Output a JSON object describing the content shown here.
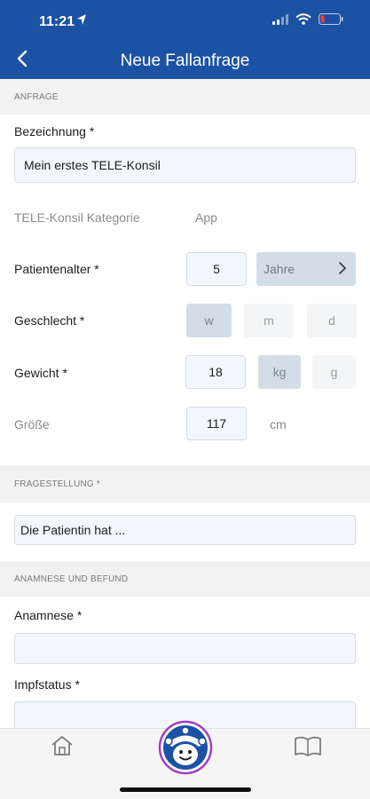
{
  "status": {
    "time": "11:21"
  },
  "nav": {
    "title": "Neue Fallanfrage"
  },
  "sections": {
    "anfrage": "ANFRAGE",
    "fragestellung": "FRAGESTELLUNG *",
    "anamnese_befund": "ANAMNESE UND BEFUND"
  },
  "form": {
    "bezeichnung_label": "Bezeichnung *",
    "bezeichnung_value": "Mein erstes TELE-Konsil",
    "kategorie_label": "TELE-Konsil Kategorie",
    "kategorie_value": "App",
    "alter_label": "Patientenalter *",
    "alter_value": "5",
    "alter_unit": "Jahre",
    "geschlecht_label": "Geschlecht *",
    "geschlecht_options": [
      "w",
      "m",
      "d"
    ],
    "geschlecht_selected": "w",
    "gewicht_label": "Gewicht *",
    "gewicht_value": "18",
    "gewicht_units": [
      "kg",
      "g"
    ],
    "gewicht_unit_selected": "kg",
    "groesse_label": "Größe",
    "groesse_value": "117",
    "groesse_unit": "cm",
    "fragestellung_value": "Die Patientin hat ...",
    "anamnese_label": "Anamnese *",
    "anamnese_value": "",
    "impfstatus_label": "Impfstatus *",
    "impfstatus_value": ""
  },
  "tabbar": {
    "items": [
      "home-icon",
      "mascot-avatar-icon",
      "book-icon"
    ]
  },
  "colors": {
    "brand": "#1c52a3",
    "avatar_ring": "#a23fc0"
  }
}
